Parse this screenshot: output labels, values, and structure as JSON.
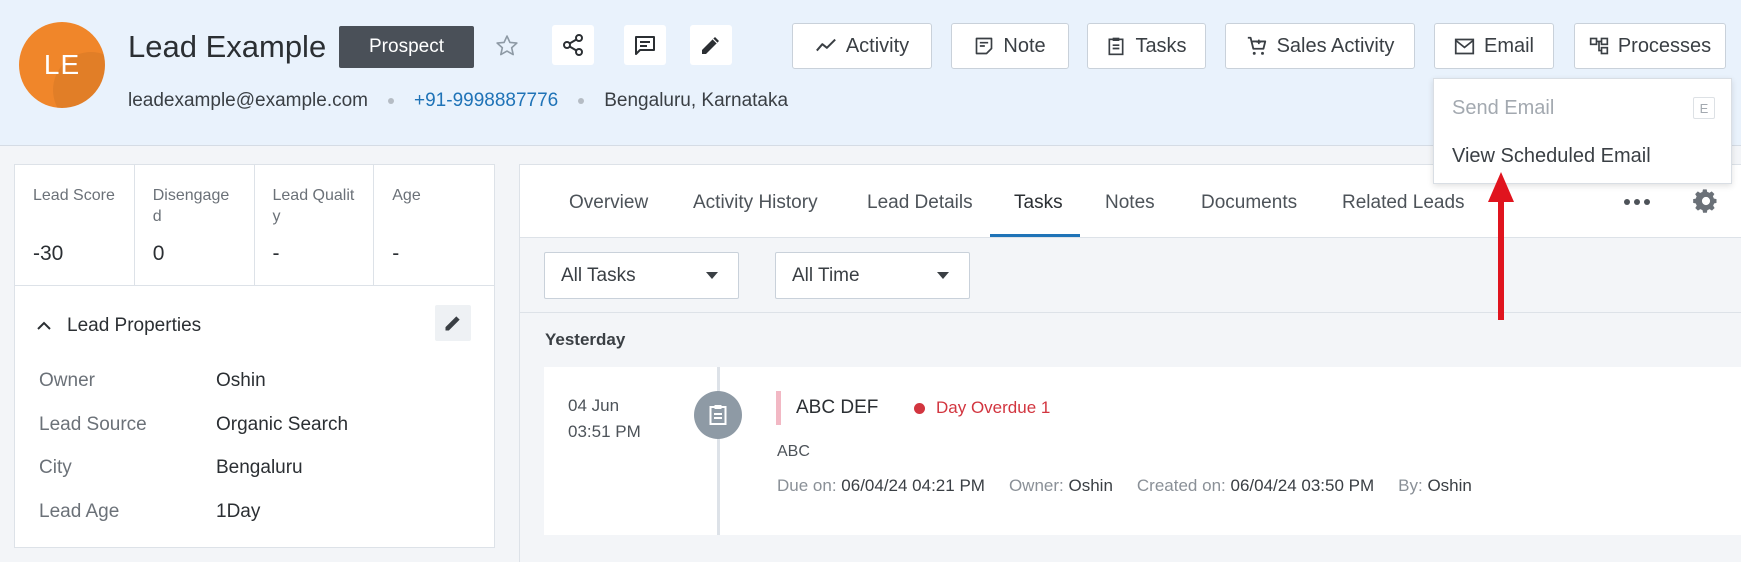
{
  "header": {
    "avatar_initials": "LE",
    "lead_name": "Lead Example",
    "stage_label": "Prospect",
    "email": "leadexample@example.com",
    "phone": "+91-9998887776",
    "location": "Bengaluru, Karnataka",
    "actions": {
      "activity": "Activity",
      "note": "Note",
      "tasks": "Tasks",
      "sales_activity": "Sales Activity",
      "email": "Email",
      "processes": "Processes"
    }
  },
  "email_menu": {
    "send_email": "Send Email",
    "send_email_shortcut": "E",
    "view_scheduled": "View Scheduled Email"
  },
  "metrics": [
    {
      "label": "Lead Score",
      "value": "-30"
    },
    {
      "label": "Disengaged",
      "value": "0"
    },
    {
      "label": "Lead Quality",
      "value": "-"
    },
    {
      "label": "Age",
      "value": "-"
    }
  ],
  "lead_properties": {
    "title": "Lead Properties",
    "rows": [
      {
        "key": "Owner",
        "value": "Oshin"
      },
      {
        "key": "Lead Source",
        "value": "Organic Search"
      },
      {
        "key": "City",
        "value": "Bengaluru"
      },
      {
        "key": "Lead Age",
        "value": "1Day"
      }
    ]
  },
  "tabs": [
    "Overview",
    "Activity History",
    "Lead Details",
    "Tasks",
    "Notes",
    "Documents",
    "Related Leads"
  ],
  "active_tab": "Tasks",
  "filters": {
    "task_filter": "All Tasks",
    "time_filter": "All Time"
  },
  "task_group": "Yesterday",
  "task": {
    "date": "04 Jun",
    "time": "03:51 PM",
    "title": "ABC DEF",
    "status": "Day Overdue 1",
    "description": "ABC",
    "due_label": "Due on:",
    "due_value": "06/04/24 04:21 PM",
    "owner_label": "Owner:",
    "owner_value": "Oshin",
    "created_label": "Created on:",
    "created_value": "06/04/24 03:50 PM",
    "by_label": "By:",
    "by_value": "Oshin"
  },
  "colors": {
    "header_bg": "#e9f2fc",
    "avatar": "#f0862a",
    "accent": "#1f73b7",
    "overdue": "#d2353f",
    "annotation_arrow": "#e0141e"
  }
}
